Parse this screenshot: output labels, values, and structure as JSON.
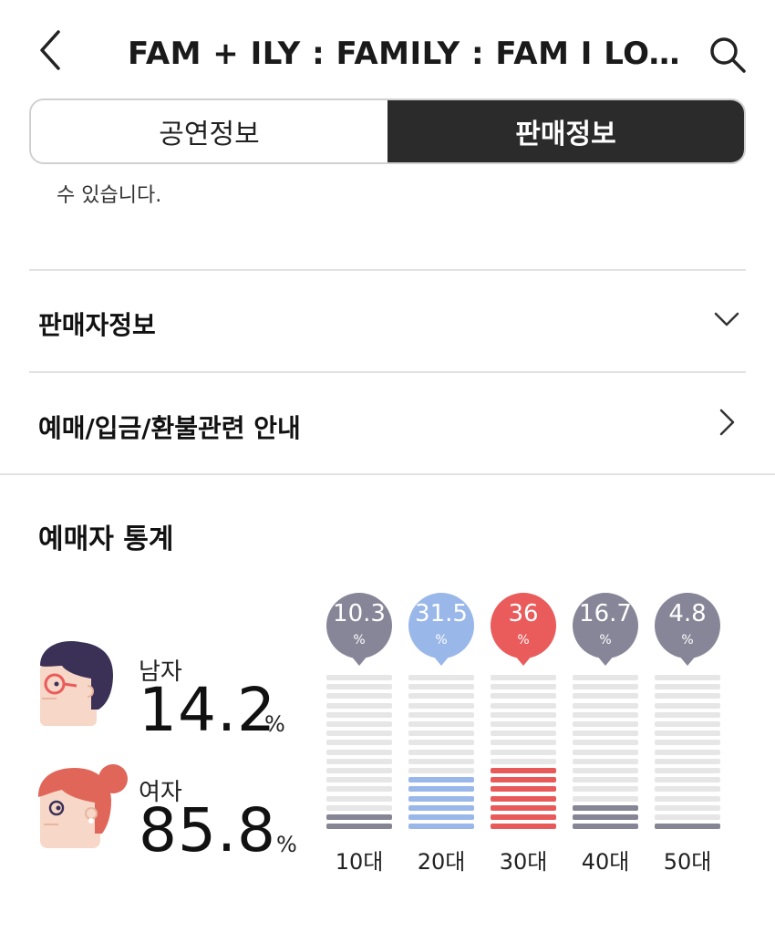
{
  "header": {
    "title": "FAM + ILY : FAMILY : FAM I LOVE YOU",
    "back_icon": "chevron-left-icon",
    "search_icon": "search-icon"
  },
  "tabs": [
    {
      "label": "공연정보",
      "active": false
    },
    {
      "label": "판매정보",
      "active": true
    }
  ],
  "notice_text": "수 있습니다.",
  "rows": [
    {
      "label": "판매자정보",
      "icon": "chevron-down-icon"
    },
    {
      "label": "예매/입금/환불관련 안내",
      "icon": "chevron-right-icon"
    }
  ],
  "stats": {
    "title": "예매자 통계",
    "male": {
      "label": "남자",
      "value": "14.2",
      "unit": "%"
    },
    "female": {
      "label": "여자",
      "value": "85.8",
      "unit": "%"
    }
  },
  "colors": {
    "gray_bubble": "#868698",
    "blue_bubble": "#9ab7ea",
    "red_bubble": "#ea5b5b",
    "bar_empty": "#e6e6e6",
    "bar_gray": "#858596",
    "bar_blue": "#9ab7ea",
    "bar_red": "#e85a5a"
  },
  "chart_data": {
    "type": "bar",
    "categories": [
      "10대",
      "20대",
      "30대",
      "40대",
      "50대"
    ],
    "values": [
      10.3,
      31.5,
      36,
      16.7,
      4.8
    ],
    "value_labels": [
      "10.3",
      "31.5",
      "36",
      "16.7",
      "4.8"
    ],
    "unit": "%",
    "colors": [
      "gray",
      "blue",
      "red",
      "gray",
      "gray"
    ],
    "total_segments": 17,
    "filled_segments": [
      2,
      6,
      7,
      3,
      1
    ]
  }
}
